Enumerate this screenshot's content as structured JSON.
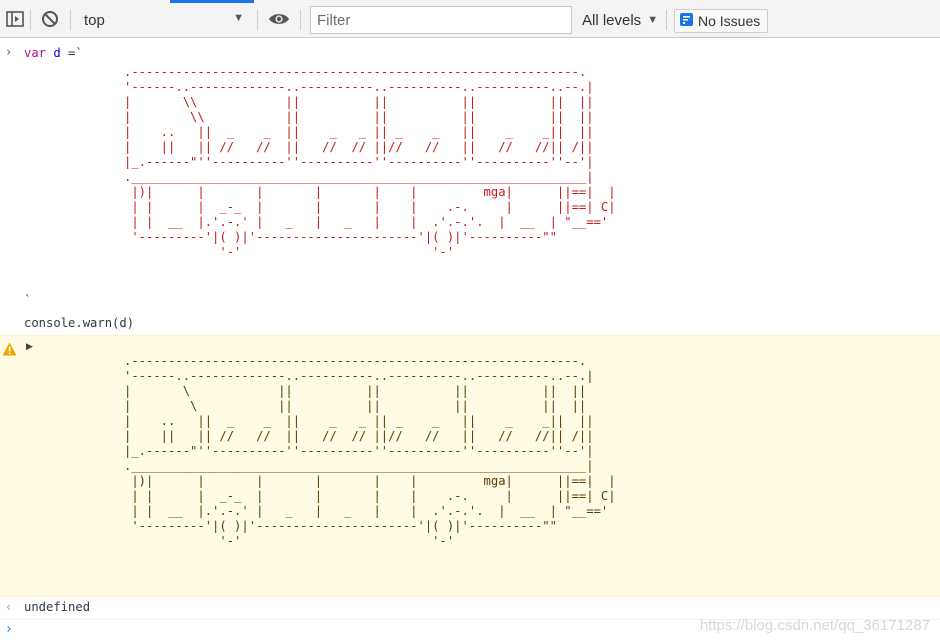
{
  "toolbar": {
    "context": "top",
    "filter_placeholder": "Filter",
    "levels_label": "All levels",
    "issues_label": "No Issues",
    "icons": [
      "sidebar-toggle-icon",
      "clear-console-icon",
      "eye-icon",
      "chevron-down-icon",
      "issues-flag-icon"
    ]
  },
  "console": {
    "cmd1_kw": "var",
    "cmd1_var": "d",
    "cmd1_rest": " =`",
    "art": ".-------------------------------------------------------------.\n'------..-------------..----------..----------..----------..--.|\n|       \\\\            ||          ||          ||          ||  ||\n|        \\\\           ||          ||          ||          ||  ||\n|    ..   ||  _    _  ||    _   _ || _    _   ||    _    _||  ||\n|    ||   || //   //  ||   //  // ||//   //   ||   //   //|| /||\n|_.------\"''----------''----------''----------''----------''--'|\n.______________________________________________________________|\n |)|      |       |       |       |    |         mga|      ||==|  |\n | |      |  _-_  |       |       |    |    .-.     |      ||==| C|\n | |  __  |.'.-.' |   _   |   _   |    |  .'.-.'.  |  __  | \"__=='\n '---------'|( )|'----------------------'|( )|'----------\"\"\n             '-'                          '-'",
    "art_end": "`",
    "cmd2": "console.warn(d)",
    "warn_art": ".-------------------------------------------------------------.\n'------..-------------..----------..----------..----------..--.|\n|       \\            ||          ||          ||          ||  ||\n|        \\           ||          ||          ||          ||  ||\n|    ..   ||  _    _  ||    _   _ || _    _   ||    _    _||  ||\n|    ||   || //   //  ||   //  // ||//   //   ||   //   //|| /||\n|_.------\"''----------''----------''----------''----------''--'|\n.______________________________________________________________|\n |)|      |       |       |       |    |         mga|      ||==|  |\n | |      |  _-_  |       |       |    |    .-.     |      ||==| C|\n | |  __  |.'.-.' |   _   |   _   |    |  .'.-.'.  |  __  | \"__=='\n '---------'|( )|'----------------------'|( )|'----------\"\"\n             '-'                          '-'",
    "result": "undefined"
  },
  "watermark": "https://blog.csdn.net/qq_36171287"
}
